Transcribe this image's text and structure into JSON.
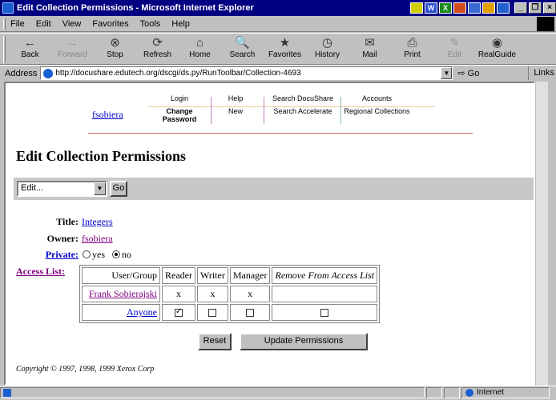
{
  "window": {
    "title": "Edit Collection Permissions - Microsoft Internet Explorer"
  },
  "menu": {
    "items": [
      "File",
      "Edit",
      "View",
      "Favorites",
      "Tools",
      "Help"
    ]
  },
  "toolbar": {
    "buttons": [
      {
        "label": "Back",
        "icon": "←"
      },
      {
        "label": "Forward",
        "icon": "→"
      },
      {
        "label": "Stop",
        "icon": "⊗"
      },
      {
        "label": "Refresh",
        "icon": "⟳"
      },
      {
        "label": "Home",
        "icon": "⌂"
      },
      {
        "label": "Search",
        "icon": "🔍"
      },
      {
        "label": "Favorites",
        "icon": "★"
      },
      {
        "label": "History",
        "icon": "◷"
      },
      {
        "label": "Mail",
        "icon": "✉"
      },
      {
        "label": "Print",
        "icon": "⎙"
      },
      {
        "label": "Edit",
        "icon": "✎"
      },
      {
        "label": "RealGuide",
        "icon": "◉"
      }
    ]
  },
  "address": {
    "label": "Address",
    "url": "http://docushare.edutech.org/dscgi/ds.py/RunToolbar/Collection-4693",
    "go": "Go",
    "links": "Links"
  },
  "nav": {
    "user": "fsobiera",
    "col1": [
      "Login",
      "Change Password"
    ],
    "col2": [
      "Help",
      "New"
    ],
    "col3": [
      "Search DocuShare",
      "Search Accelerate"
    ],
    "col4": [
      "Accounts",
      "Regional Collections"
    ]
  },
  "page": {
    "title": "Edit Collection Permissions",
    "action_select": "Edit...",
    "action_go": "Go",
    "title_label": "Title:",
    "title_value": "Integers",
    "owner_label": "Owner:",
    "owner_value": "fsobiera",
    "private_label": "Private:",
    "private_yes": "yes",
    "private_no": "no",
    "private_selected": "no",
    "access_label": "Access List:"
  },
  "acl": {
    "headers": [
      "User/Group",
      "Reader",
      "Writer",
      "Manager",
      "Remove From Access List"
    ],
    "rows": [
      {
        "name": "Frank Sobierajski",
        "reader": "x",
        "writer": "x",
        "manager": "x"
      },
      {
        "name": "Anyone",
        "reader": "checked",
        "writer": "unchecked",
        "manager": "unchecked",
        "remove": "unchecked"
      }
    ]
  },
  "buttons": {
    "reset": "Reset",
    "update": "Update Permissions"
  },
  "copyright": "Copyright © 1997, 1998, 1999 Xerox Corp",
  "status": {
    "zone": "Internet"
  }
}
